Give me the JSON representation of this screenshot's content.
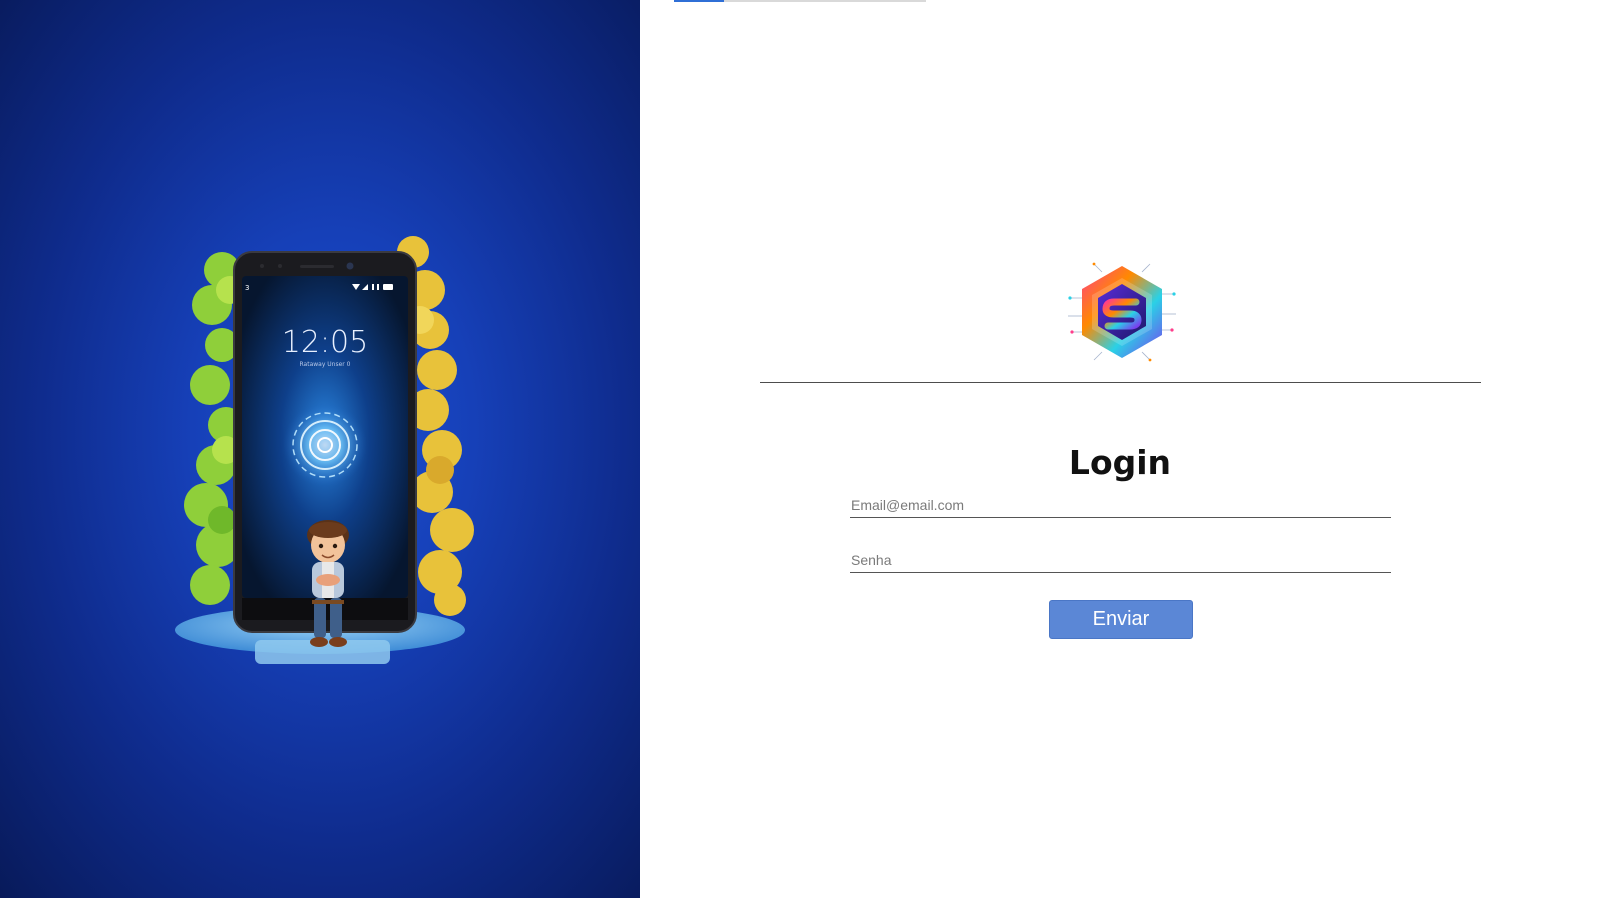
{
  "hero": {
    "phone_time": "12:05",
    "phone_date": "Rataway Unser 0",
    "phone_status_left": "3",
    "image_alt": "Phone with character illustration"
  },
  "tabs": {
    "active_index": 0
  },
  "logo": {
    "name": "brand-logo"
  },
  "form": {
    "title": "Login",
    "email_placeholder": "Email@email.com",
    "password_placeholder": "Senha",
    "submit_label": "Enviar"
  },
  "colors": {
    "hero_blue": "#1640b8",
    "button_blue": "#5b87d6",
    "tab_active": "#2f6fd6"
  }
}
